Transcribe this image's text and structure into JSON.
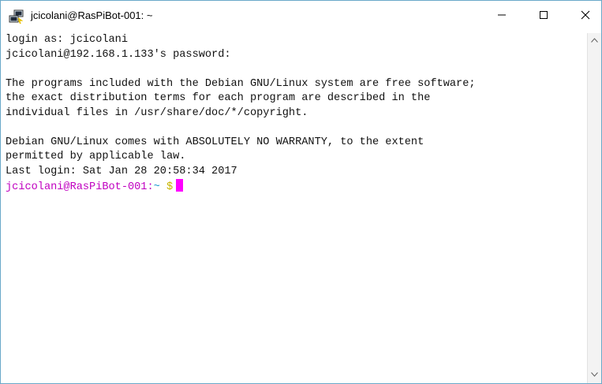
{
  "window": {
    "title": "jcicolani@RasPiBot-001: ~",
    "app_icon": "putty-icon",
    "controls": {
      "minimize_icon": "minimize-icon",
      "maximize_icon": "maximize-icon",
      "close_icon": "close-icon"
    }
  },
  "terminal": {
    "lines": [
      "login as: jcicolani",
      "jcicolani@192.168.1.133's password:",
      "",
      "The programs included with the Debian GNU/Linux system are free software;",
      "the exact distribution terms for each program are described in the",
      "individual files in /usr/share/doc/*/copyright.",
      "",
      "Debian GNU/Linux comes with ABSOLUTELY NO WARRANTY, to the extent",
      "permitted by applicable law.",
      "Last login: Sat Jan 28 20:58:34 2017"
    ],
    "prompt": {
      "user_host": "jcicolani@RasPiBot-001",
      "separator": ":",
      "path": "~",
      "symbol": "$"
    }
  },
  "colors": {
    "prompt_user": "#c000c0",
    "prompt_path": "#1c9ad0",
    "prompt_symbol": "#c8b400",
    "cursor": "#ff00ff",
    "border": "#6aa9c9"
  },
  "scrollbar": {
    "up_icon": "scroll-up-arrow-icon",
    "down_icon": "scroll-down-arrow-icon"
  }
}
